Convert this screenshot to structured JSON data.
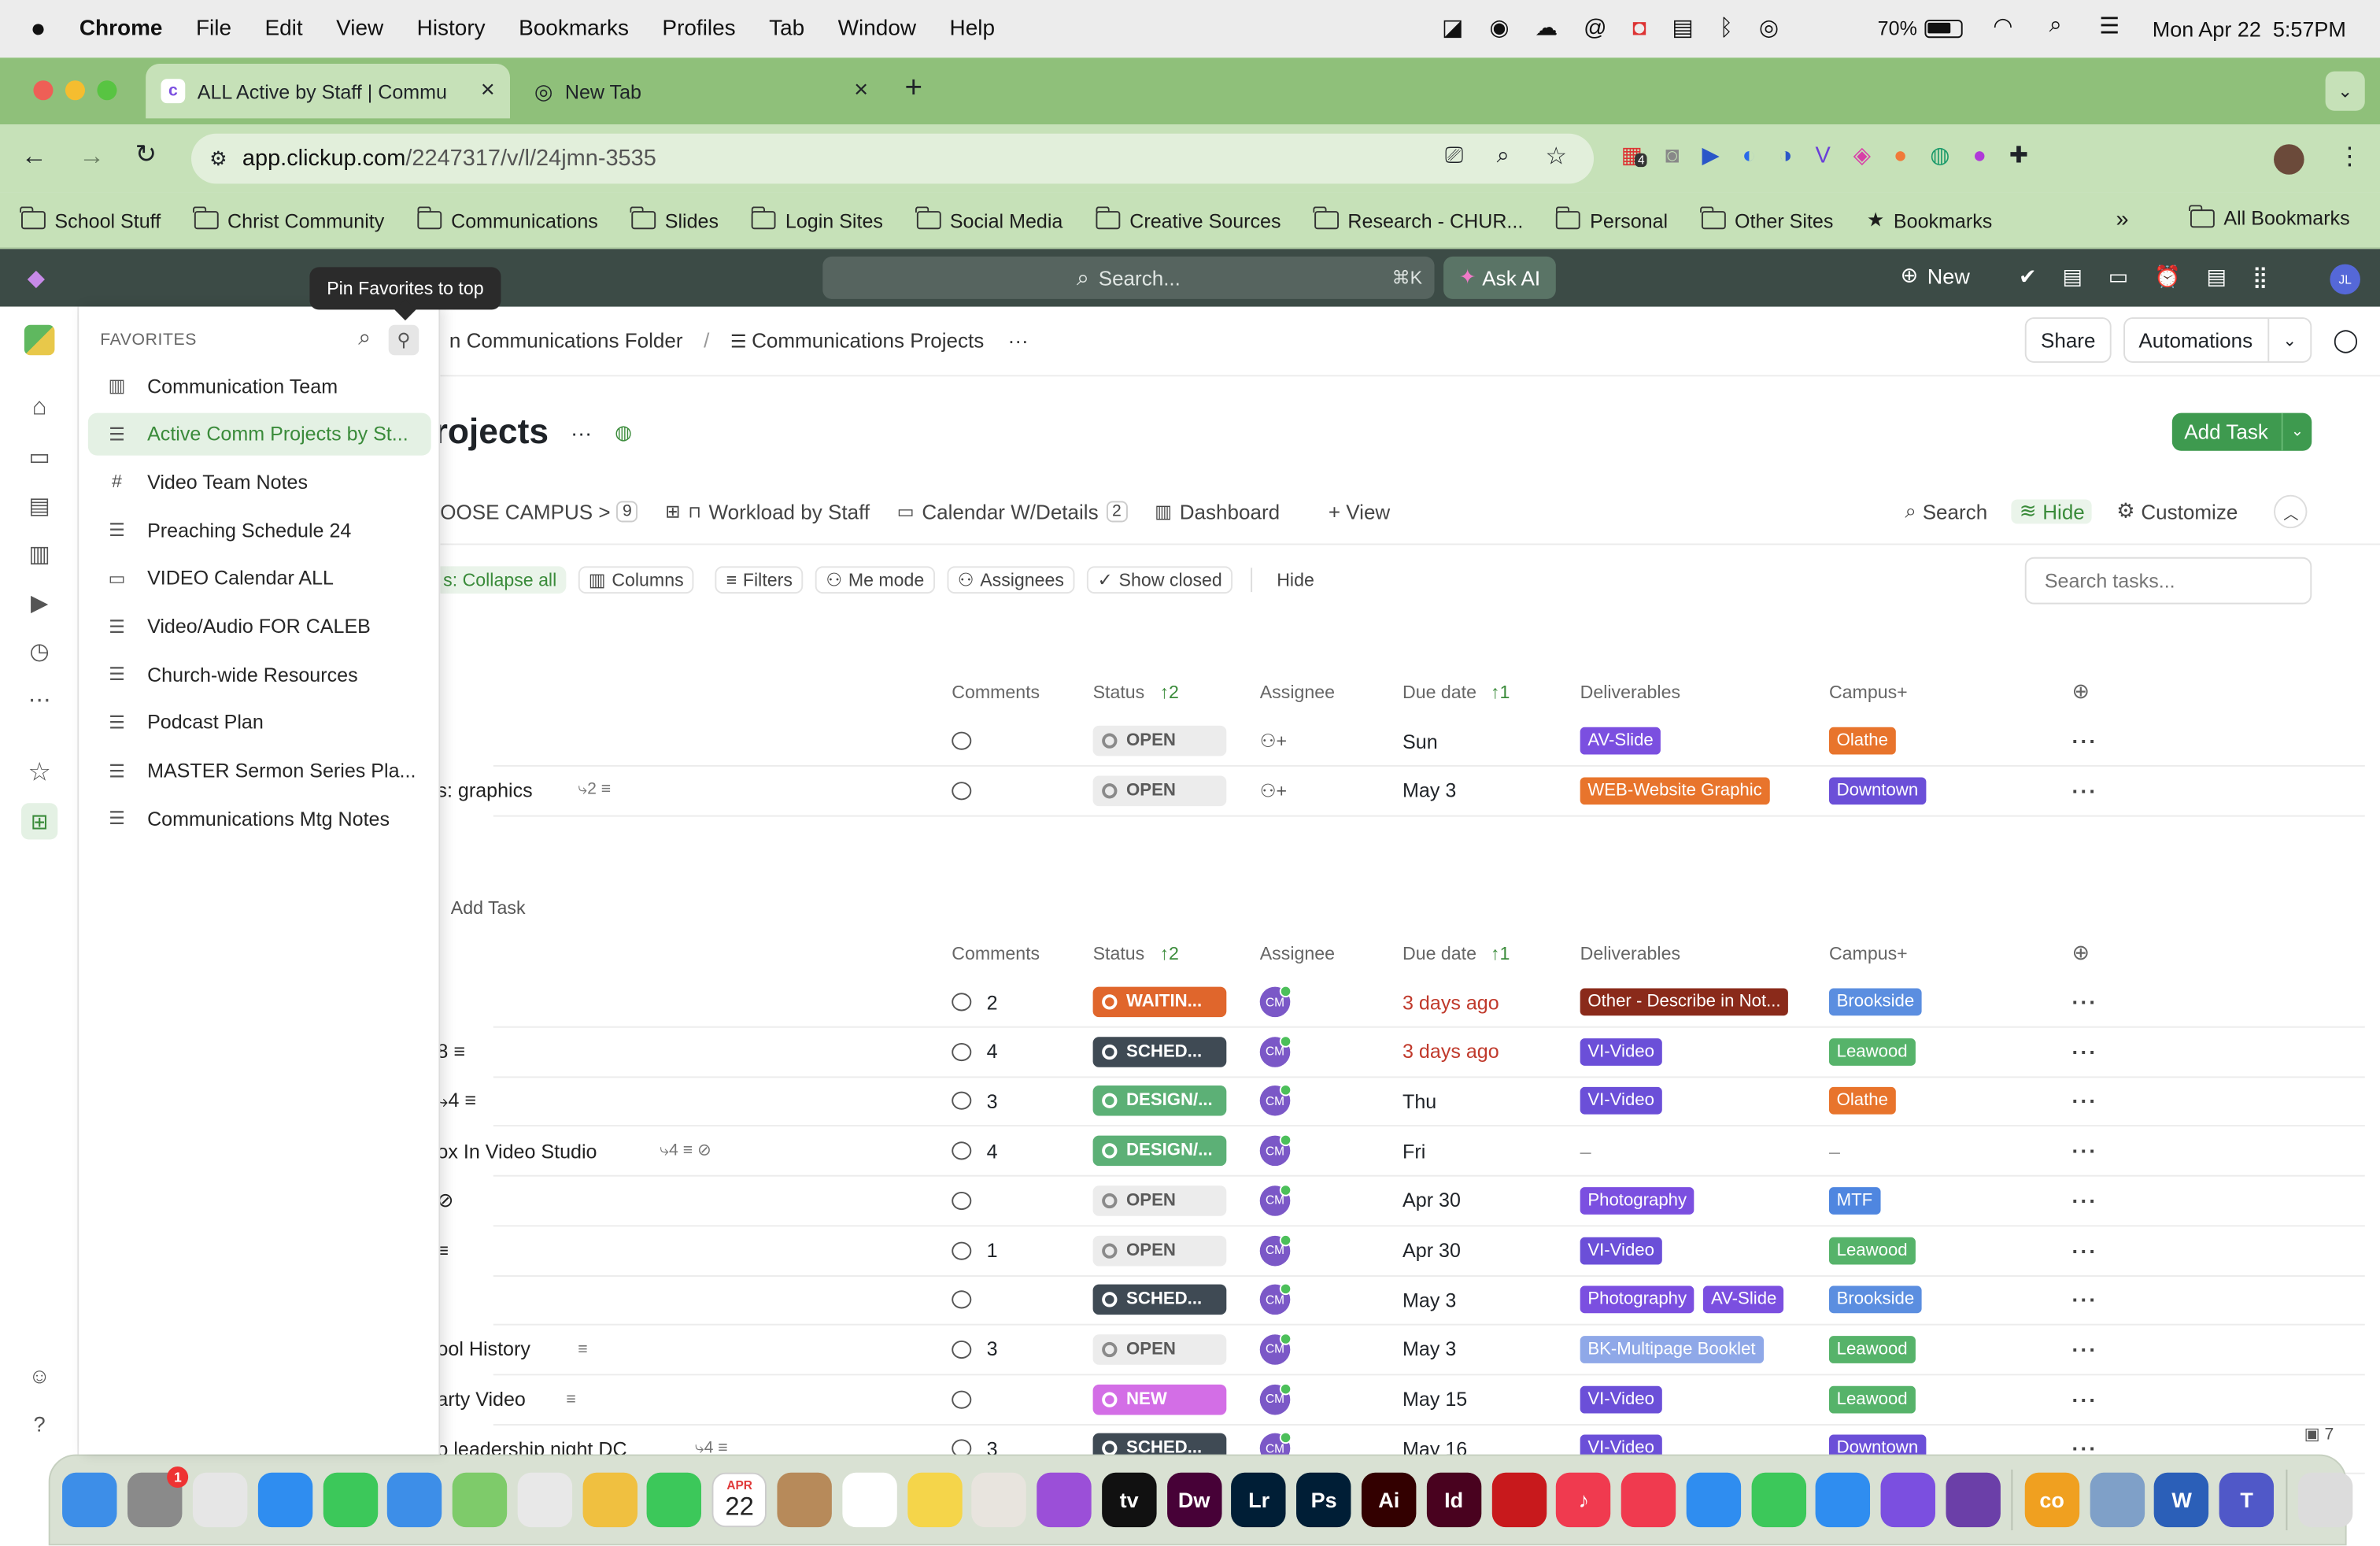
{
  "menubar": {
    "app": "Chrome",
    "items": [
      "File",
      "Edit",
      "View",
      "History",
      "Bookmarks",
      "Profiles",
      "Tab",
      "Window",
      "Help"
    ],
    "battery": "70%",
    "datetime": "Mon Apr 22  5:57PM"
  },
  "browser": {
    "tabs": [
      {
        "title": "ALL Active by Staff | Commu",
        "close": "×"
      },
      {
        "title": "New Tab",
        "close": "×"
      }
    ],
    "new_tab": "+",
    "url_host": "app.clickup.com",
    "url_path": "/2247317/v/l/24jmn-3535",
    "ext_badge": "4",
    "bookmarks": [
      "School Stuff",
      "Christ Community",
      "Communications",
      "Slides",
      "Login Sites",
      "Social Media",
      "Creative Sources",
      "Research - CHUR...",
      "Personal",
      "Other Sites",
      "Bookmarks"
    ],
    "bookmarks_more": "»",
    "all_bookmarks": "All Bookmarks"
  },
  "clickup": {
    "search_placeholder": "Search...",
    "search_shortcut": "⌘K",
    "ask_ai": "Ask AI",
    "new_label": "New",
    "user_initials": "JL"
  },
  "tooltip": "Pin Favorites to top",
  "favorites": {
    "header": "FAVORITES",
    "items": [
      {
        "label": "Communication Team",
        "icon": "dashboard-icon",
        "glyph": "▥"
      },
      {
        "label": "Active Comm Projects by St...",
        "icon": "list-icon",
        "glyph": "☰",
        "active": true
      },
      {
        "label": "Video Team Notes",
        "icon": "hashtag-icon",
        "glyph": "#"
      },
      {
        "label": "Preaching Schedule 24",
        "icon": "list-icon",
        "glyph": "☰"
      },
      {
        "label": "VIDEO Calendar ALL",
        "icon": "calendar-icon",
        "glyph": "▭"
      },
      {
        "label": "Video/Audio FOR CALEB",
        "icon": "list-icon",
        "glyph": "☰"
      },
      {
        "label": "Church-wide Resources",
        "icon": "list-icon",
        "glyph": "☰"
      },
      {
        "label": "Podcast Plan",
        "icon": "list-icon",
        "glyph": "☰"
      },
      {
        "label": "MASTER Sermon Series Pla...",
        "icon": "list-icon",
        "glyph": "☰"
      },
      {
        "label": "Communications Mtg Notes",
        "icon": "list-icon",
        "glyph": "☰"
      }
    ]
  },
  "breadcrumb": {
    "folder": "n Communications Folder",
    "sep": "/",
    "list": "Communications Projects",
    "more": "···"
  },
  "header_actions": {
    "share": "Share",
    "automations": "Automations"
  },
  "page_title": "rojects",
  "title_more": "···",
  "add_task": "Add Task",
  "views": {
    "first": "OOSE CAMPUS >",
    "first_count": "9",
    "workload": "Workload by Staff",
    "calendar": "Calendar W/Details",
    "calendar_count": "2",
    "dashboard": "Dashboard",
    "add_view": "+ View",
    "search": "Search",
    "hide": "Hide",
    "customize": "Customize"
  },
  "filters": {
    "collapse": "s: Collapse all",
    "columns": "Columns",
    "filters": "Filters",
    "me_mode": "Me mode",
    "assignees": "Assignees",
    "show_closed": "Show closed",
    "hide": "Hide",
    "search_placeholder": "Search tasks..."
  },
  "columns": {
    "comments": "Comments",
    "status": "Status",
    "status_sort": "↑2",
    "assignee": "Assignee",
    "due": "Due date",
    "due_sort": "↑1",
    "deliverables": "Deliverables",
    "campus": "Campus+"
  },
  "group1_rows": [
    {
      "name": "",
      "comments": "",
      "status": "OPEN",
      "status_class": "st-open",
      "assignee": "",
      "due": "Sun",
      "due_overdue": false,
      "deliverables": [
        {
          "label": "AV-Slide",
          "color": "#7b4fe0"
        }
      ],
      "campus": {
        "label": "Olathe",
        "color": "#e8742c"
      }
    },
    {
      "name": "s: graphics",
      "meta": "⤷2 ≡",
      "comments": "",
      "status": "OPEN",
      "status_class": "st-open",
      "assignee": "",
      "due": "May 3",
      "due_overdue": false,
      "deliverables": [
        {
          "label": "WEB-Website Graphic",
          "color": "#e8742c"
        }
      ],
      "campus": {
        "label": "Downtown",
        "color": "#6b4fd8"
      }
    }
  ],
  "add_task_row": "Add Task",
  "group2_rows": [
    {
      "name": "",
      "comments": "2",
      "status": "WAITIN...",
      "status_class": "st-wait",
      "assignee": "CM",
      "due": "3 days ago",
      "due_overdue": true,
      "deliverables": [
        {
          "label": "Other - Describe in Not...",
          "color": "#8a2a1a"
        }
      ],
      "campus": {
        "label": "Brookside",
        "color": "#5b8ee0"
      }
    },
    {
      "name": "8 ≡",
      "comments": "4",
      "status": "SCHED...",
      "status_class": "st-sched",
      "assignee": "CM",
      "due": "3 days ago",
      "due_overdue": true,
      "deliverables": [
        {
          "label": "VI-Video",
          "color": "#6b4fd8"
        }
      ],
      "campus": {
        "label": "Leawood",
        "color": "#56b36a"
      }
    },
    {
      "name": "⤷4 ≡",
      "comments": "3",
      "status": "DESIGN/...",
      "status_class": "st-design",
      "assignee": "CM",
      "due": "Thu",
      "due_overdue": false,
      "deliverables": [
        {
          "label": "VI-Video",
          "color": "#6b4fd8"
        }
      ],
      "campus": {
        "label": "Olathe",
        "color": "#e8742c"
      }
    },
    {
      "name": "ox In Video Studio",
      "meta": "⤷4 ≡ ⊘",
      "comments": "4",
      "status": "DESIGN/...",
      "status_class": "st-design",
      "assignee": "CM",
      "due": "Fri",
      "due_overdue": false,
      "deliverables": [],
      "deliverables_empty": "–",
      "campus": {
        "label": "",
        "color": ""
      },
      "campus_empty": "–"
    },
    {
      "name": "⊘",
      "comments": "",
      "status": "OPEN",
      "status_class": "st-open",
      "assignee": "CM",
      "due": "Apr 30",
      "due_overdue": false,
      "deliverables": [
        {
          "label": "Photography",
          "color": "#7b4fe0"
        }
      ],
      "campus": {
        "label": "MTF",
        "color": "#4f86e0"
      }
    },
    {
      "name": "≡",
      "comments": "1",
      "status": "OPEN",
      "status_class": "st-open",
      "assignee": "CM",
      "due": "Apr 30",
      "due_overdue": false,
      "deliverables": [
        {
          "label": "VI-Video",
          "color": "#6b4fd8"
        }
      ],
      "campus": {
        "label": "Leawood",
        "color": "#56b36a"
      }
    },
    {
      "name": "",
      "comments": "",
      "status": "SCHED...",
      "status_class": "st-sched",
      "assignee": "CM",
      "due": "May 3",
      "due_overdue": false,
      "deliverables": [
        {
          "label": "Photography",
          "color": "#7b4fe0"
        },
        {
          "label": "AV-Slide",
          "color": "#7b4fe0"
        }
      ],
      "campus": {
        "label": "Brookside",
        "color": "#5b8ee0"
      }
    },
    {
      "name": "ool History",
      "meta": "≡",
      "comments": "3",
      "status": "OPEN",
      "status_class": "st-open",
      "assignee": "CM",
      "due": "May 3",
      "due_overdue": false,
      "deliverables": [
        {
          "label": "BK-Multipage Booklet",
          "color": "#8fa8e8"
        }
      ],
      "campus": {
        "label": "Leawood",
        "color": "#56b36a"
      }
    },
    {
      "name": "arty Video",
      "meta": "≡",
      "comments": "",
      "status": "NEW",
      "status_class": "st-new",
      "assignee": "CM",
      "due": "May 15",
      "due_overdue": false,
      "deliverables": [
        {
          "label": "VI-Video",
          "color": "#6b4fd8"
        }
      ],
      "campus": {
        "label": "Leawood",
        "color": "#56b36a"
      }
    },
    {
      "name": "o leadership night DC",
      "meta": "⤷4 ≡",
      "comments": "3",
      "status": "SCHED...",
      "status_class": "st-sched",
      "assignee": "CM",
      "due": "May 16",
      "due_overdue": false,
      "deliverables": [
        {
          "label": "VI-Video",
          "color": "#6b4fd8"
        }
      ],
      "campus": {
        "label": "Downtown",
        "color": "#6b4fd8"
      }
    }
  ],
  "corner_badge": "7",
  "dock": {
    "calendar_month": "APR",
    "calendar_day": "22",
    "notification_badge": "1",
    "apps": [
      {
        "name": "finder-icon",
        "color": "#3d8ee8",
        "text": ""
      },
      {
        "name": "settings-icon",
        "color": "#8a8a8a",
        "text": ""
      },
      {
        "name": "launchpad-icon",
        "color": "#e6e6e6",
        "text": ""
      },
      {
        "name": "safari-icon",
        "color": "#2f8df0",
        "text": ""
      },
      {
        "name": "messages-icon",
        "color": "#3cc85a",
        "text": ""
      },
      {
        "name": "mail-icon",
        "color": "#3d8ee8",
        "text": ""
      },
      {
        "name": "maps-icon",
        "color": "#7ecb6a",
        "text": ""
      },
      {
        "name": "chrome-icon",
        "color": "#e8e8e8",
        "text": ""
      },
      {
        "name": "photos-icon",
        "color": "#f0c040",
        "text": ""
      },
      {
        "name": "facetime-icon",
        "color": "#3cc85a",
        "text": ""
      },
      {
        "name": "calendar-app-icon",
        "color": "#ffffff",
        "text": ""
      },
      {
        "name": "contacts-icon",
        "color": "#b78a5a",
        "text": ""
      },
      {
        "name": "reminders-icon",
        "color": "#ffffff",
        "text": ""
      },
      {
        "name": "notes-icon",
        "color": "#f5d54a",
        "text": ""
      },
      {
        "name": "script-icon",
        "color": "#e8e4de",
        "text": ""
      },
      {
        "name": "podcasts-icon",
        "color": "#9b4fd8",
        "text": ""
      },
      {
        "name": "tv-icon",
        "color": "#111111",
        "text": "tv"
      },
      {
        "name": "dreamweaver-icon",
        "color": "#470137",
        "text": "Dw"
      },
      {
        "name": "lightroom-icon",
        "color": "#001e36",
        "text": "Lr"
      },
      {
        "name": "photoshop-icon",
        "color": "#001e36",
        "text": "Ps"
      },
      {
        "name": "illustrator-icon",
        "color": "#330000",
        "text": "Ai"
      },
      {
        "name": "indesign-icon",
        "color": "#49021f",
        "text": "Id"
      },
      {
        "name": "acrobat-icon",
        "color": "#c8191c",
        "text": ""
      },
      {
        "name": "music-icon",
        "color": "#f03a4f",
        "text": "♪"
      },
      {
        "name": "news-icon",
        "color": "#f03a4f",
        "text": ""
      },
      {
        "name": "keynote-icon",
        "color": "#2f8df0",
        "text": ""
      },
      {
        "name": "numbers-icon",
        "color": "#3cc85a",
        "text": ""
      },
      {
        "name": "app-store-icon",
        "color": "#2f8df0",
        "text": ""
      },
      {
        "name": "clickup-icon",
        "color": "#7b4fe0",
        "text": ""
      },
      {
        "name": "business-icon",
        "color": "#6b3fa8",
        "text": ""
      },
      {
        "name": "creative-cloud-icon",
        "color": "#f0a020",
        "text": "co"
      },
      {
        "name": "preview-icon",
        "color": "#7fa0c8",
        "text": ""
      },
      {
        "name": "word-icon",
        "color": "#2b5fb8",
        "text": "W"
      },
      {
        "name": "teams-icon",
        "color": "#5058c8",
        "text": "T"
      },
      {
        "name": "trash-icon",
        "color": "#dcdcdc",
        "text": ""
      }
    ]
  }
}
